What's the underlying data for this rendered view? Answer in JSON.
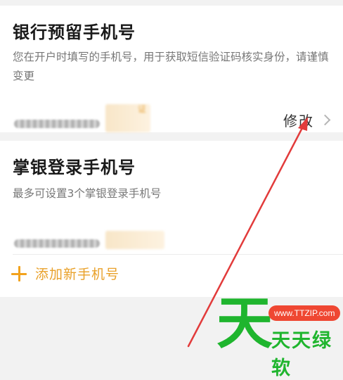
{
  "bank_phone_section": {
    "title": "银行预留手机号",
    "description": "您在开户时填写的手机号，用于获取短信验证码核实身份，请谨慎变更",
    "tag_text": "证",
    "modify_label": "修改"
  },
  "login_phone_section": {
    "title": "掌银登录手机号",
    "description": "最多可设置3个掌银登录手机号",
    "add_label": "添加新手机号"
  },
  "watermark": {
    "char": "天",
    "url": "www.TTZIP.com",
    "name": "天天绿软"
  },
  "colors": {
    "accent": "#f2a21c",
    "annotation_arrow": "#e23b3b",
    "watermark_green": "#1fb52e",
    "watermark_red": "#ef4732"
  }
}
